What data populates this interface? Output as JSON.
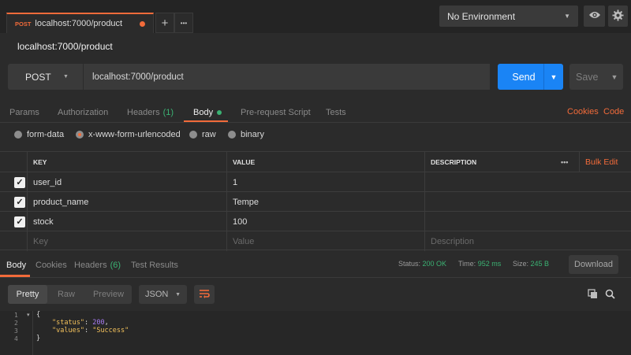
{
  "tab": {
    "method": "POST",
    "url": "localhost:7000/product"
  },
  "tab_bar": {
    "add_label": "+",
    "more_label": "•••"
  },
  "environment": {
    "selected": "No Environment"
  },
  "request": {
    "title": "localhost:7000/product",
    "method": "POST",
    "url": "localhost:7000/product",
    "send_label": "Send",
    "save_label": "Save"
  },
  "request_tabs": {
    "params": "Params",
    "authorization": "Authorization",
    "headers": "Headers",
    "headers_count": "(1)",
    "body": "Body",
    "prerequest": "Pre-request Script",
    "tests": "Tests",
    "cookies": "Cookies",
    "code": "Code"
  },
  "body_types": [
    "form-data",
    "x-www-form-urlencoded",
    "raw",
    "binary"
  ],
  "body_type_selected": "x-www-form-urlencoded",
  "table": {
    "headers": {
      "key": "KEY",
      "value": "VALUE",
      "description": "DESCRIPTION"
    },
    "more": "•••",
    "bulk_edit": "Bulk Edit",
    "rows": [
      {
        "checked": true,
        "key": "user_id",
        "value": "1",
        "description": ""
      },
      {
        "checked": true,
        "key": "product_name",
        "value": "Tempe",
        "description": ""
      },
      {
        "checked": true,
        "key": "stock",
        "value": "100",
        "description": ""
      }
    ],
    "placeholders": {
      "key": "Key",
      "value": "Value",
      "description": "Description"
    }
  },
  "response": {
    "tabs": {
      "body": "Body",
      "cookies": "Cookies",
      "headers": "Headers",
      "headers_count": "(6)",
      "tests": "Test Results"
    },
    "status_label": "Status:",
    "status": "200 OK",
    "time_label": "Time:",
    "time": "952 ms",
    "size_label": "Size:",
    "size": "245 B",
    "download": "Download",
    "formats": {
      "pretty": "Pretty",
      "raw": "Raw",
      "preview": "Preview"
    },
    "language": "JSON",
    "code_lines": [
      "{",
      "\"status\": 200,",
      "\"values\": \"Success\"",
      "}"
    ],
    "line_numbers": [
      "1",
      "2",
      "3",
      "4"
    ]
  },
  "colors": {
    "accent": "#f26b3a",
    "send": "#1a84f5",
    "ok": "#3bb273",
    "background": "#2b2b2b"
  },
  "icons": [
    "eye-icon",
    "gear-icon",
    "wrap-icon",
    "copy-icon",
    "search-icon",
    "chevron-down-icon",
    "check-icon"
  ]
}
